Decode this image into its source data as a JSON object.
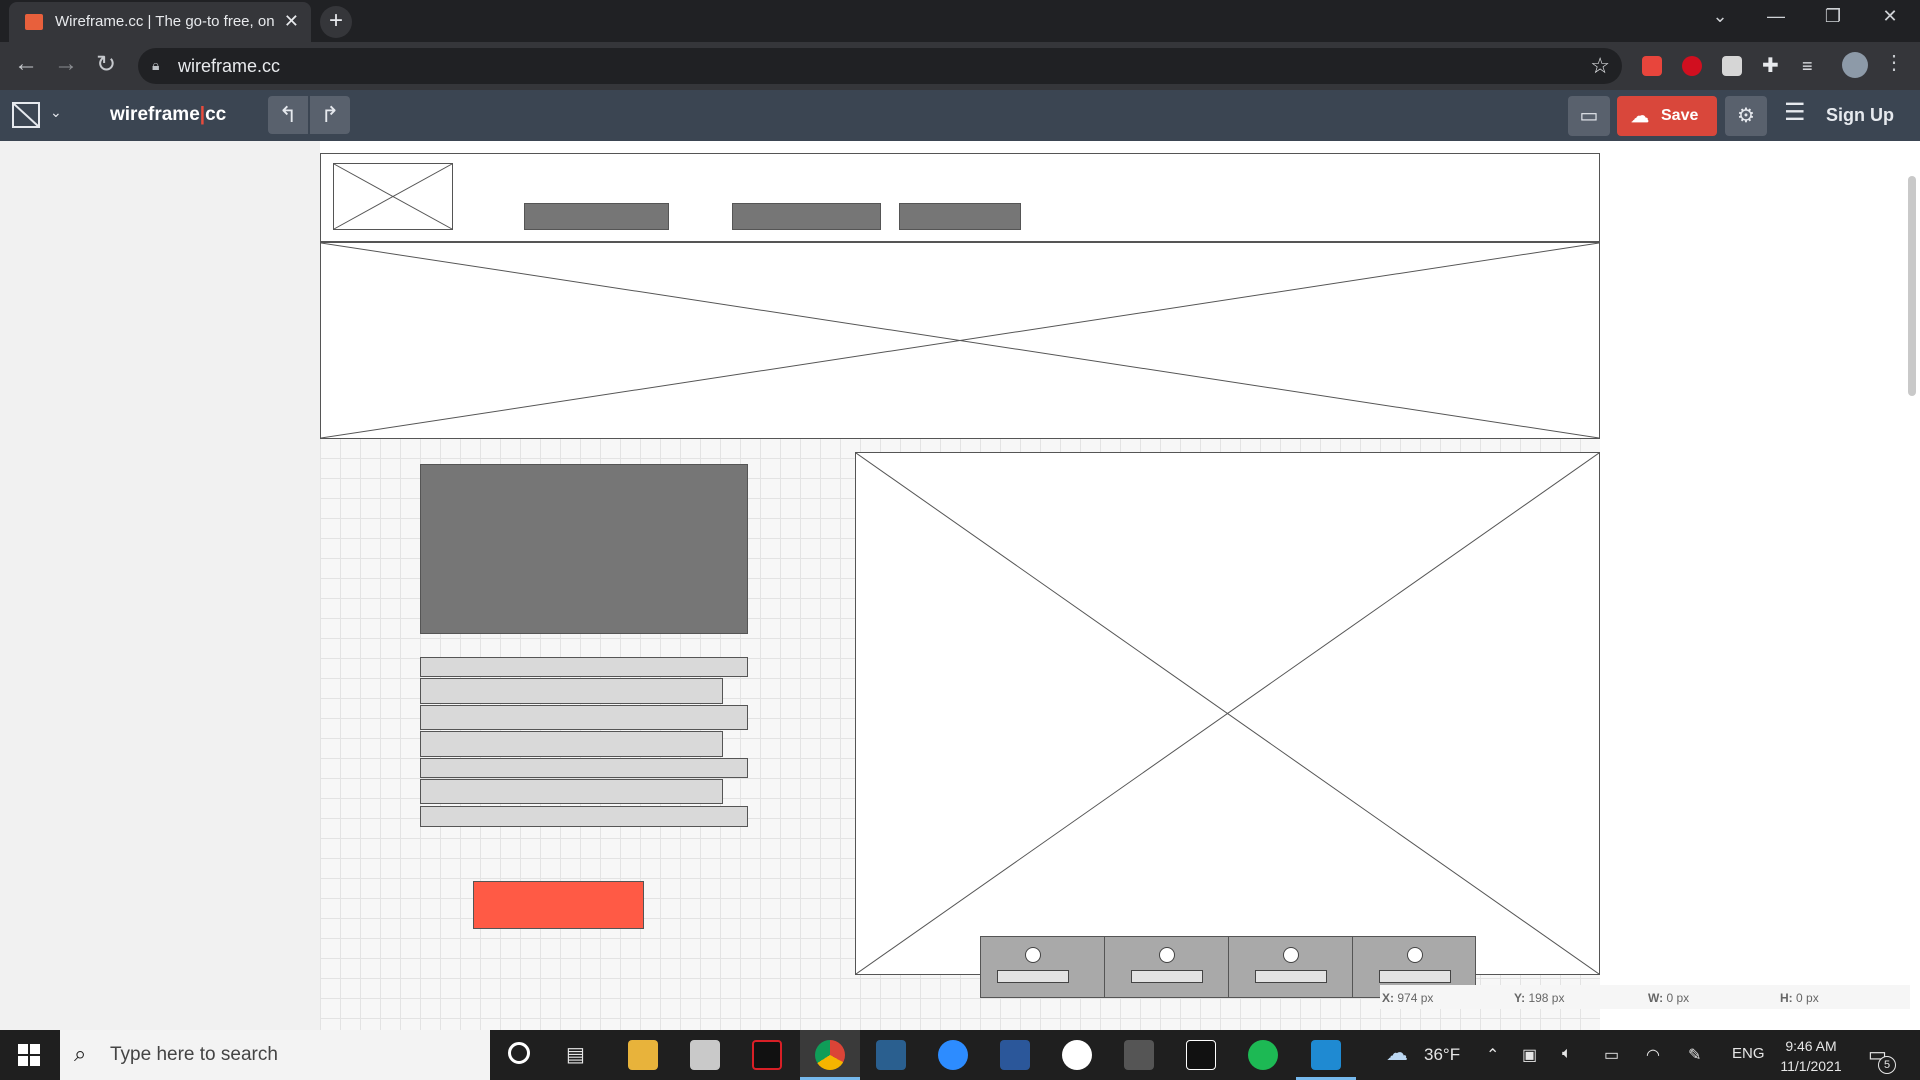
{
  "browser": {
    "tab_title": "Wireframe.cc | The go-to free, on",
    "new_tab": "+",
    "url": "wireframe.cc"
  },
  "app": {
    "logo_left": "wireframe",
    "logo_sep": "|",
    "logo_right": "cc",
    "save_label": "Save",
    "signup_label": "Sign Up"
  },
  "coords": {
    "x_label": "X:",
    "x_value": "974 px",
    "y_label": "Y:",
    "y_value": "198 px",
    "w_label": "W:",
    "w_value": "0 px",
    "h_label": "H:",
    "h_value": "0 px"
  },
  "taskbar": {
    "search_placeholder": "Type here to search",
    "weather": "36°F",
    "language": "ENG",
    "time": "9:46 AM",
    "date": "11/1/2021",
    "notifications": "5"
  },
  "colors": {
    "save": "#d9473b",
    "cta": "#ff5a45",
    "toolbar": "#3b4552"
  },
  "icons": [
    "back-icon",
    "forward-icon",
    "reload-icon",
    "lock-icon",
    "star-icon",
    "extensions-icon",
    "undo-icon",
    "redo-icon",
    "comment-icon",
    "upload-cloud-icon",
    "settings-icon",
    "hamburger-icon",
    "windows-start-icon",
    "search-icon"
  ]
}
